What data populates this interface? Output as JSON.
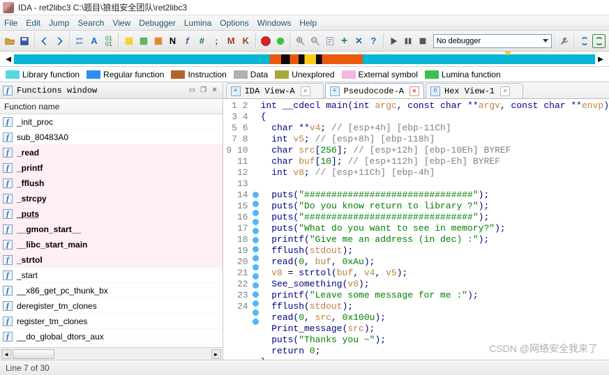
{
  "title": "IDA - ret2libc3 C:\\题目\\狼组安全团队\\ret2libc3",
  "menus": [
    "File",
    "Edit",
    "Jump",
    "Search",
    "View",
    "Debugger",
    "Lumina",
    "Options",
    "Windows",
    "Help"
  ],
  "toolbar": {
    "debugger_select": "No debugger"
  },
  "legend": {
    "items": [
      {
        "color": "#57d7e4",
        "label": "Library function"
      },
      {
        "color": "#2d8df4",
        "label": "Regular function"
      },
      {
        "color": "#b5622b",
        "label": "Instruction"
      },
      {
        "color": "#b0b0b0",
        "label": "Data"
      },
      {
        "color": "#a8a838",
        "label": "Unexplored"
      },
      {
        "color": "#f4b6e2",
        "label": "External symbol"
      },
      {
        "color": "#3cc24a",
        "label": "Lumina function"
      }
    ]
  },
  "functions_pane": {
    "title": "Functions window",
    "column": "Function name",
    "items": [
      {
        "name": "_init_proc",
        "ext": false
      },
      {
        "name": "sub_80483A0",
        "ext": false
      },
      {
        "name": "_read",
        "ext": true
      },
      {
        "name": "_printf",
        "ext": true
      },
      {
        "name": "_fflush",
        "ext": true
      },
      {
        "name": "_strcpy",
        "ext": true
      },
      {
        "name": "_puts",
        "ext": true,
        "selected": true
      },
      {
        "name": "__gmon_start__",
        "ext": true
      },
      {
        "name": "__libc_start_main",
        "ext": true
      },
      {
        "name": "_strtol",
        "ext": true
      },
      {
        "name": "_start",
        "ext": false
      },
      {
        "name": "__x86_get_pc_thunk_bx",
        "ext": false
      },
      {
        "name": "deregister_tm_clones",
        "ext": false
      },
      {
        "name": "register_tm_clones",
        "ext": false
      },
      {
        "name": "__do_global_dtors_aux",
        "ext": false
      }
    ]
  },
  "right_tabs": {
    "ida_view": "IDA View-A",
    "pseudo": "Pseudocode-A",
    "hex": "Hex View-1"
  },
  "code": {
    "lines": [
      {
        "n": 1,
        "dot": false,
        "html": "<span class='ty'>int</span> <span class='kw'>__cdecl</span> <span class='fn'>main</span>(<span class='ty'>int</span> <span class='id'>argc</span>, <span class='ty'>const char</span> **<span class='id'>argv</span>, <span class='ty'>const char</span> **<span class='id'>envp</span>)"
      },
      {
        "n": 2,
        "dot": false,
        "html": "{"
      },
      {
        "n": 3,
        "dot": false,
        "html": "  <span class='ty'>char</span> **<span class='id'>v4</span>; <span class='cm'>// [esp+4h] [ebp-11Ch]</span>"
      },
      {
        "n": 4,
        "dot": false,
        "html": "  <span class='ty'>int</span> <span class='id'>v5</span>; <span class='cm'>// [esp+8h] [ebp-118h]</span>"
      },
      {
        "n": 5,
        "dot": false,
        "html": "  <span class='ty'>char</span> <span class='id'>src</span>[<span class='num'>256</span>]; <span class='cm'>// [esp+12h] [ebp-10Eh] BYREF</span>"
      },
      {
        "n": 6,
        "dot": false,
        "html": "  <span class='ty'>char</span> <span class='id'>buf</span>[<span class='num'>10</span>]; <span class='cm'>// [esp+112h] [ebp-Eh] BYREF</span>"
      },
      {
        "n": 7,
        "dot": false,
        "html": "  <span class='ty'>int</span> <span class='id'>v8</span>; <span class='cm'>// [esp+11Ch] [ebp-4h]</span>"
      },
      {
        "n": 8,
        "dot": false,
        "html": ""
      },
      {
        "n": 9,
        "dot": true,
        "html": "  <span class='fn'>puts</span>(<span class='str'>\"###############################\"</span>);"
      },
      {
        "n": 10,
        "dot": true,
        "html": "  <span class='fn'>puts</span>(<span class='str'>\"Do you know return to library ?\"</span>);"
      },
      {
        "n": 11,
        "dot": true,
        "html": "  <span class='fn'>puts</span>(<span class='str'>\"###############################\"</span>);"
      },
      {
        "n": 12,
        "dot": true,
        "html": "  <span class='fn'>puts</span>(<span class='str'>\"What do you want to see in memory?\"</span>);"
      },
      {
        "n": 13,
        "dot": true,
        "html": "  <span class='fn'>printf</span>(<span class='str'>\"Give me an address (in dec) :\"</span>);"
      },
      {
        "n": 14,
        "dot": true,
        "html": "  <span class='fn'>fflush</span>(<span class='id'>stdout</span>);"
      },
      {
        "n": 15,
        "dot": true,
        "html": "  <span class='fn'>read</span>(<span class='num'>0</span>, <span class='id'>buf</span>, <span class='num'>0xAu</span>);"
      },
      {
        "n": 16,
        "dot": true,
        "html": "  <span class='id'>v8</span> <span class='op'>=</span> <span class='fn'>strtol</span>(<span class='id'>buf</span>, <span class='id'>v4</span>, <span class='id'>v5</span>);"
      },
      {
        "n": 17,
        "dot": true,
        "html": "  <span class='fn'>See_something</span>(<span class='id'>v8</span>);"
      },
      {
        "n": 18,
        "dot": true,
        "html": "  <span class='fn'>printf</span>(<span class='str'>\"Leave some message for me :\"</span>);"
      },
      {
        "n": 19,
        "dot": true,
        "html": "  <span class='fn'>fflush</span>(<span class='id'>stdout</span>);"
      },
      {
        "n": 20,
        "dot": true,
        "html": "  <span class='fn'>read</span>(<span class='num'>0</span>, <span class='id'>src</span>, <span class='num'>0x100u</span>);"
      },
      {
        "n": 21,
        "dot": true,
        "html": "  <span class='fn'>Print_message</span>(<span class='id'>src</span>);"
      },
      {
        "n": 22,
        "dot": true,
        "html": "  <span class='fn'>puts</span>(<span class='str'>\"Thanks you ~\"</span>);"
      },
      {
        "n": 23,
        "dot": true,
        "html": "  <span class='kw'>return</span> <span class='num'>0</span>;"
      },
      {
        "n": 24,
        "dot": false,
        "html": "}"
      }
    ]
  },
  "status": "Line 7 of 30",
  "watermark": "CSDN @网络安全我来了"
}
